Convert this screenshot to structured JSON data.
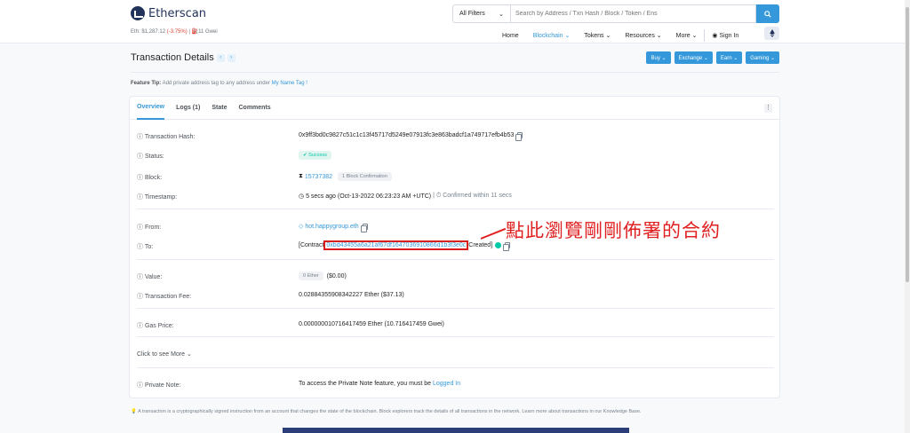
{
  "header": {
    "logo_text": "Etherscan",
    "price_prefix": "Eth: $1,287.12",
    "price_change": "(-3.75%)",
    "gas": "| ⛽11 Gwei",
    "filter_label": "All Filters",
    "search_placeholder": "Search by Address / Txn Hash / Block / Token / Ens",
    "nav": {
      "home": "Home",
      "blockchain": "Blockchain ⌄",
      "tokens": "Tokens ⌄",
      "resources": "Resources ⌄",
      "more": "More ⌄",
      "signin": "Sign In"
    }
  },
  "page": {
    "title": "Transaction Details",
    "buttons": [
      "Buy ⌄",
      "Exchange ⌄",
      "Earn ⌄",
      "Gaming ⌄"
    ],
    "tip_label": "Feature Tip:",
    "tip_text": " Add private address tag to any address under ",
    "tip_link": "My Name Tag !"
  },
  "tabs": [
    "Overview",
    "Logs (1)",
    "State",
    "Comments"
  ],
  "details": {
    "tx_hash_label": "Transaction Hash:",
    "tx_hash": "0x9ff3bd0c9827c51c1c13f45717d5249e07913fc3e863badcf1a749717efb4b53",
    "status_label": "Status:",
    "status": "Success",
    "block_label": "Block:",
    "block": "15737382",
    "block_conf": "1 Block Confirmation",
    "timestamp_label": "Timestamp:",
    "timestamp": "5 secs ago (Oct-13-2022 06:23:23 AM +UTC)",
    "timestamp_extra": "| ⏱ Confirmed within 11 secs",
    "from_label": "From:",
    "from": "hot.happygroup.eth",
    "to_label": "To:",
    "to_prefix": "[Contract ",
    "to_address": "0xbd43455a6a21af67df1647036910866d1b3f3e0c",
    "to_suffix": " Created]",
    "value_label": "Value:",
    "value_badge": "0 Ether",
    "value_usd": "($0.00)",
    "fee_label": "Transaction Fee:",
    "fee": "0.02884355908342227 Ether ($37.13)",
    "gas_label": "Gas Price:",
    "gas_price": "0.000000010716417459 Ether (10.716417459 Gwei)",
    "see_more": "Click to see More ⌄",
    "note_label": "Private Note:",
    "note_text": "To access the Private Note feature, you must be ",
    "note_link": "Logged In"
  },
  "annotation": "點此瀏覽剛剛佈署的合約",
  "footer_note": "💡 A transaction is a cryptographically signed instruction from an account that changes the state of the blockchain. Block explorers track the details of all transactions in the network. Learn more about transactions in our Knowledge Base.",
  "colors": {
    "accent": "#3498db",
    "success": "#00c9a7",
    "annotation": "#e02020"
  }
}
